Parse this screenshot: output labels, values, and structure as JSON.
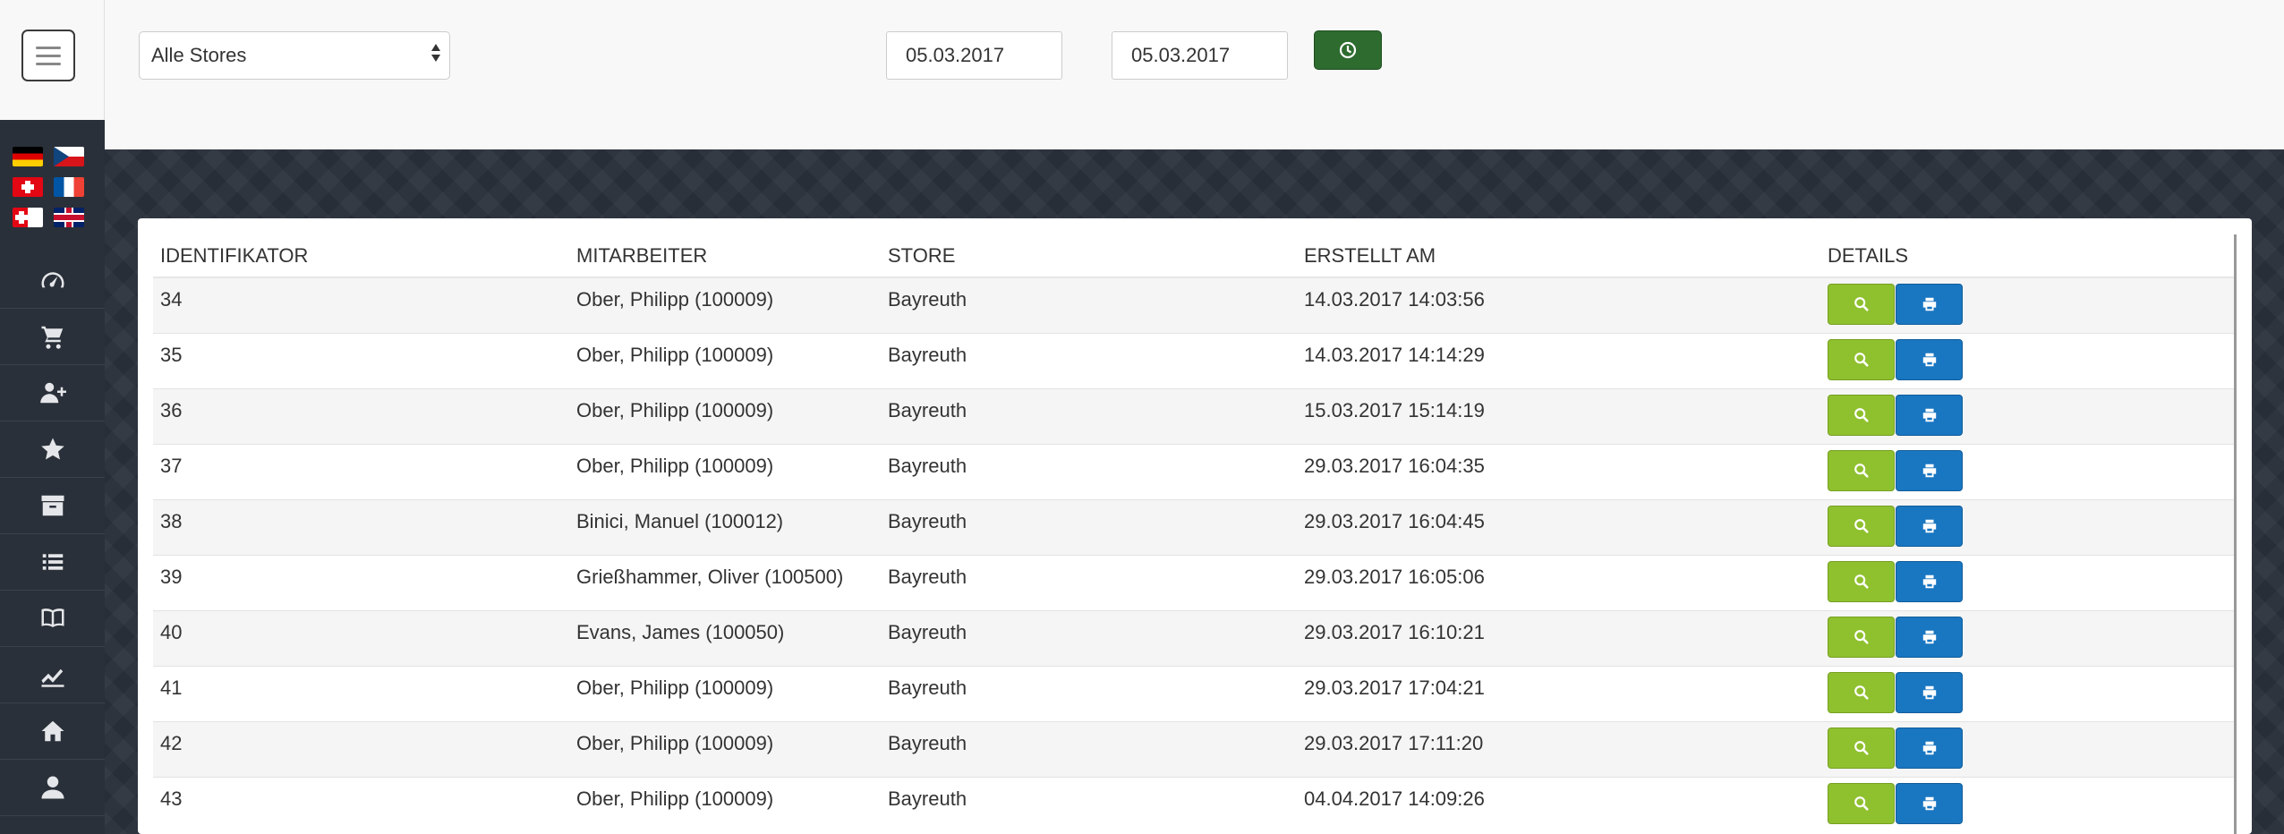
{
  "sidebar": {
    "languages": [
      {
        "name": "german-flag",
        "code": "de"
      },
      {
        "name": "czech-flag",
        "code": "cz"
      },
      {
        "name": "swiss-flag",
        "code": "ch"
      },
      {
        "name": "french-flag",
        "code": "fr"
      },
      {
        "name": "swiss-french-flag",
        "code": "ch-fr"
      },
      {
        "name": "uk-flag",
        "code": "en"
      }
    ],
    "nav_icons": [
      "dashboard-icon",
      "cart-icon",
      "add-user-icon",
      "star-icon",
      "archive-icon",
      "list-icon",
      "book-icon",
      "chart-icon",
      "home-icon",
      "user-icon"
    ]
  },
  "filters": {
    "store": "Alle Stores",
    "date_from": "05.03.2017",
    "date_to": "05.03.2017"
  },
  "table": {
    "headers": [
      "IDENTIFIKATOR",
      "MITARBEITER",
      "STORE",
      "ERSTELLT AM",
      "DETAILS"
    ],
    "rows": [
      {
        "id": "34",
        "employee": "Ober, Philipp (100009)",
        "store": "Bayreuth",
        "created": "14.03.2017 14:03:56"
      },
      {
        "id": "35",
        "employee": "Ober, Philipp (100009)",
        "store": "Bayreuth",
        "created": "14.03.2017 14:14:29"
      },
      {
        "id": "36",
        "employee": "Ober, Philipp (100009)",
        "store": "Bayreuth",
        "created": "15.03.2017 15:14:19"
      },
      {
        "id": "37",
        "employee": "Ober, Philipp (100009)",
        "store": "Bayreuth",
        "created": "29.03.2017 16:04:35"
      },
      {
        "id": "38",
        "employee": "Binici, Manuel (100012)",
        "store": "Bayreuth",
        "created": "29.03.2017 16:04:45"
      },
      {
        "id": "39",
        "employee": "Grießhammer, Oliver (100500)",
        "store": "Bayreuth",
        "created": "29.03.2017 16:05:06"
      },
      {
        "id": "40",
        "employee": "Evans, James (100050)",
        "store": "Bayreuth",
        "created": "29.03.2017 16:10:21"
      },
      {
        "id": "41",
        "employee": "Ober, Philipp (100009)",
        "store": "Bayreuth",
        "created": "29.03.2017 17:04:21"
      },
      {
        "id": "42",
        "employee": "Ober, Philipp (100009)",
        "store": "Bayreuth",
        "created": "29.03.2017 17:11:20"
      },
      {
        "id": "43",
        "employee": "Ober, Philipp (100009)",
        "store": "Bayreuth",
        "created": "04.04.2017 14:09:26"
      }
    ]
  },
  "colors": {
    "sidebar": "#2a3039",
    "go_button": "#2e6b2f",
    "view_button": "#8fc02e",
    "print_button": "#1976c1"
  }
}
